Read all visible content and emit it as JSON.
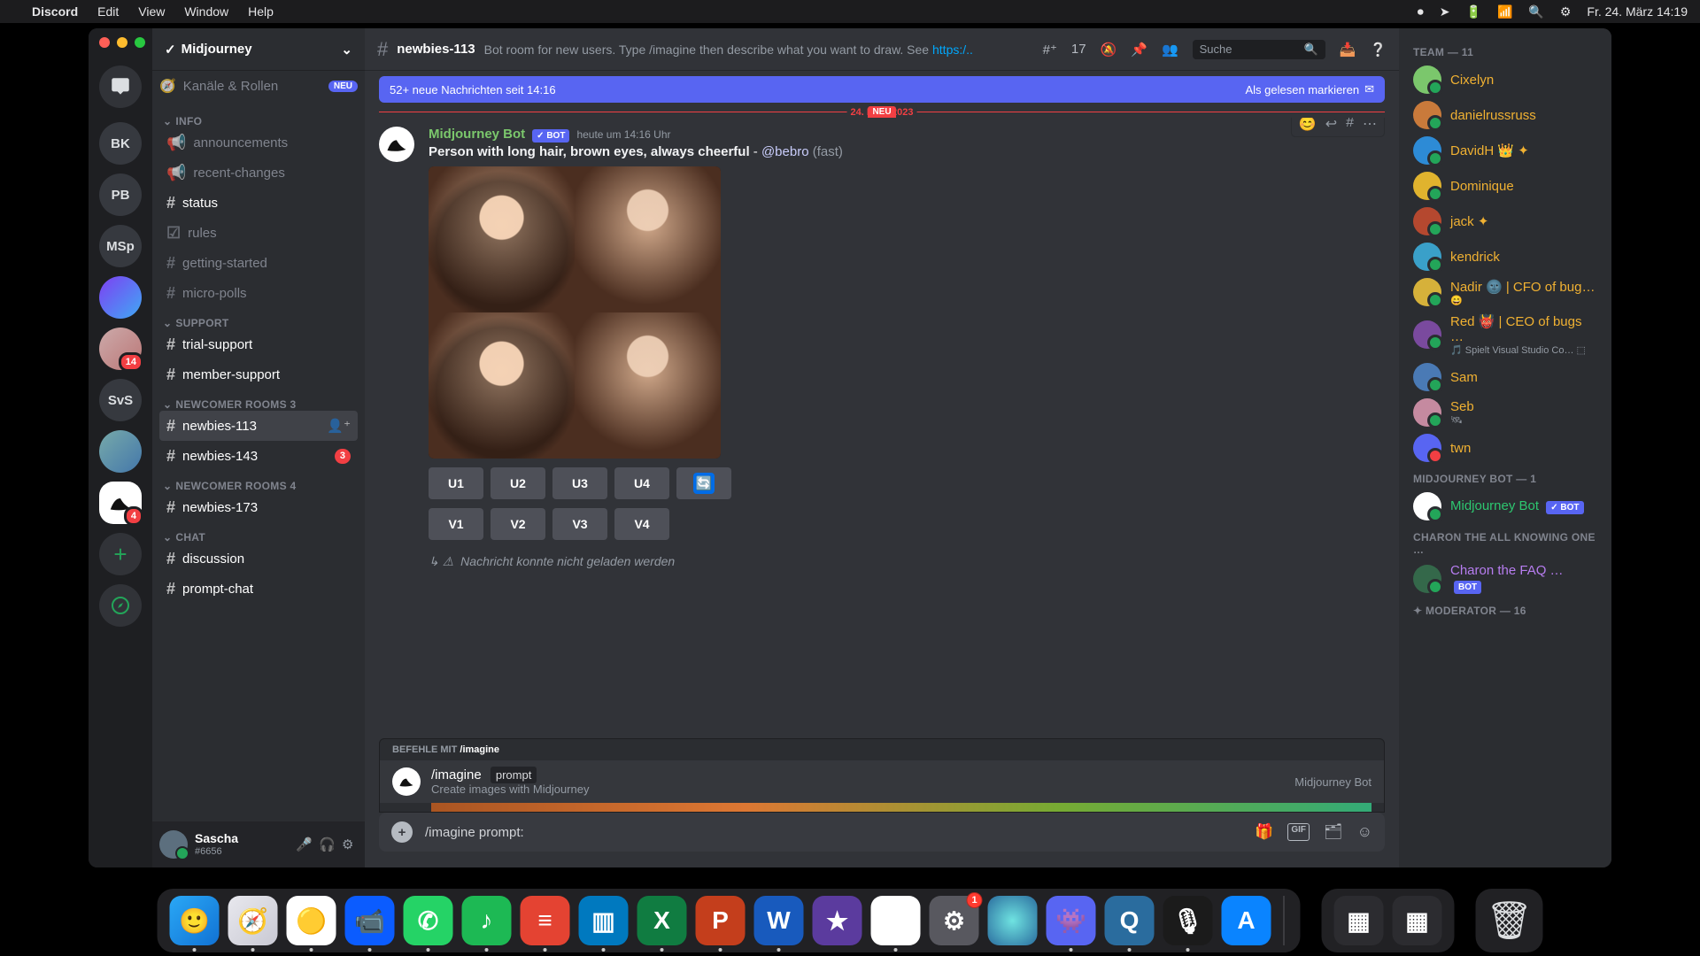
{
  "menubar": {
    "app": "Discord",
    "items": [
      "Edit",
      "View",
      "Window",
      "Help"
    ],
    "clock": "Fr. 24. März  14:19"
  },
  "guild": {
    "name": "Midjourney",
    "roles_label": "Kanäle & Rollen",
    "roles_new": "NEU"
  },
  "server_icons": [
    {
      "type": "home",
      "glyph": "💬"
    },
    {
      "type": "text",
      "label": "BK"
    },
    {
      "type": "text",
      "label": "PB"
    },
    {
      "type": "text",
      "label": "MSp"
    },
    {
      "type": "img"
    },
    {
      "type": "avatar",
      "badge": "14"
    },
    {
      "type": "text",
      "label": "SvS"
    },
    {
      "type": "avatar2"
    },
    {
      "type": "sel",
      "badge": "4"
    },
    {
      "type": "green",
      "glyph": "+"
    },
    {
      "type": "compass",
      "glyph": "🧭"
    }
  ],
  "categories": [
    {
      "name": "INFO",
      "channels": [
        {
          "icon": "📢",
          "name": "announcements"
        },
        {
          "icon": "📢",
          "name": "recent-changes"
        },
        {
          "icon": "#",
          "name": "status",
          "bright": true
        },
        {
          "icon": "☑",
          "name": "rules"
        },
        {
          "icon": "#",
          "name": "getting-started"
        },
        {
          "icon": "#",
          "name": "micro-polls"
        }
      ]
    },
    {
      "name": "SUPPORT",
      "channels": [
        {
          "icon": "#",
          "name": "trial-support",
          "bright": true
        },
        {
          "icon": "#",
          "name": "member-support",
          "bright": true
        }
      ]
    },
    {
      "name": "NEWCOMER ROOMS 3",
      "channels": [
        {
          "icon": "#",
          "name": "newbies-113",
          "selected": true,
          "add_icon": true
        },
        {
          "icon": "#",
          "name": "newbies-143",
          "bright": true,
          "badge": "3"
        }
      ]
    },
    {
      "name": "NEWCOMER ROOMS 4",
      "channels": [
        {
          "icon": "#",
          "name": "newbies-173",
          "bright": true
        }
      ]
    },
    {
      "name": "CHAT",
      "channels": [
        {
          "icon": "#",
          "name": "discussion",
          "bright": true
        },
        {
          "icon": "#",
          "name": "prompt-chat",
          "bright": true
        }
      ]
    }
  ],
  "user_panel": {
    "name": "Sascha",
    "tag": "#6656"
  },
  "topbar": {
    "channel": "newbies-113",
    "desc_prefix": "Bot room for new users. Type /imagine then describe what you want to draw. See ",
    "desc_link": "https:/..",
    "threads": "17",
    "search_placeholder": "Suche"
  },
  "banner": {
    "left": "52+ neue Nachrichten seit 14:16",
    "right": "Als gelesen markieren"
  },
  "divider": {
    "date": "24. März 2023",
    "neu": "NEU"
  },
  "message": {
    "author": "Midjourney Bot",
    "bot": "✓ BOT",
    "time": "heute um 14:16 Uhr",
    "prompt": "Person with long hair, brown eyes, always cheerful",
    "mention": "@bebro",
    "suffix": "(fast)",
    "buttons_u": [
      "U1",
      "U2",
      "U3",
      "U4"
    ],
    "buttons_v": [
      "V1",
      "V2",
      "V3",
      "V4"
    ],
    "error": "Nachricht konnte nicht geladen werden"
  },
  "command_popup": {
    "header_pre": "BEFEHLE MIT ",
    "header_cmd": "/imagine",
    "command": "/imagine",
    "param": "prompt",
    "desc": "Create images with Midjourney",
    "source": "Midjourney Bot"
  },
  "composer": {
    "text": "/imagine prompt:"
  },
  "members": {
    "team_header": "TEAM — 11",
    "team": [
      {
        "name": "Cixelyn",
        "color": "#f0b132",
        "av": "#7bc76c"
      },
      {
        "name": "danielrussruss",
        "color": "#f0b132",
        "av": "#c97a3b"
      },
      {
        "name": "DavidH 👑 ✦",
        "color": "#f0b132",
        "av": "#2d8bd6"
      },
      {
        "name": "Dominique",
        "color": "#f0b132",
        "av": "#e0b32e"
      },
      {
        "name": "jack ✦",
        "color": "#f0b132",
        "av": "#b5482f"
      },
      {
        "name": "kendrick",
        "color": "#f0b132",
        "av": "#3aa0c9"
      },
      {
        "name": "Nadir 🌚  | CFO of bug…",
        "color": "#f0b132",
        "av": "#d6b13a",
        "sub": "😄"
      },
      {
        "name": "Red 👹  | CEO of bugs …",
        "color": "#f0b132",
        "av": "#7a4a9e",
        "sub": "🎵 Spielt Visual Studio Co…  ⬚"
      },
      {
        "name": "Sam",
        "color": "#f0b132",
        "av": "#4a7ab5"
      },
      {
        "name": "Seb",
        "color": "#f0b132",
        "av": "#c58aa0",
        "sub": "🛰"
      },
      {
        "name": "twn",
        "color": "#f0b132",
        "av": "#5865f2",
        "dnd": true
      }
    ],
    "bot_header": "MIDJOURNEY BOT — 1",
    "bot": {
      "name": "Midjourney Bot",
      "tag": "✓ BOT"
    },
    "charon_header": "CHARON THE ALL KNOWING ONE …",
    "charon": {
      "name": "Charon the FAQ …",
      "tag": "BOT"
    },
    "mod_header": "✦ MODERATOR — 16"
  },
  "dock": [
    {
      "name": "finder",
      "bg": "linear-gradient(135deg,#2aa8f6,#1172d4)",
      "glyph": "🙂",
      "dot": true
    },
    {
      "name": "safari",
      "bg": "linear-gradient(135deg,#e8e8ee,#c9c9d3)",
      "glyph": "🧭",
      "dot": true
    },
    {
      "name": "chrome",
      "bg": "#fff",
      "glyph": "🟡",
      "dot": true
    },
    {
      "name": "zoom",
      "bg": "#0b5cff",
      "glyph": "📹",
      "dot": true
    },
    {
      "name": "whatsapp",
      "bg": "#25d366",
      "glyph": "✆",
      "dot": true
    },
    {
      "name": "spotify",
      "bg": "#1db954",
      "glyph": "♪",
      "dot": true
    },
    {
      "name": "todoist",
      "bg": "#e44332",
      "glyph": "≡",
      "dot": true
    },
    {
      "name": "trello",
      "bg": "#0079bf",
      "glyph": "▥",
      "dot": true
    },
    {
      "name": "excel",
      "bg": "#107c41",
      "glyph": "X",
      "dot": true
    },
    {
      "name": "powerpoint",
      "bg": "#c43e1c",
      "glyph": "P",
      "dot": true
    },
    {
      "name": "word",
      "bg": "#185abd",
      "glyph": "W",
      "dot": true
    },
    {
      "name": "imovie",
      "bg": "#5b3b9e",
      "glyph": "★"
    },
    {
      "name": "drive",
      "bg": "#fff",
      "glyph": "▲",
      "dot": true
    },
    {
      "name": "settings",
      "bg": "#58585f",
      "glyph": "⚙",
      "badge": "1"
    },
    {
      "name": "siri",
      "bg": "radial-gradient(circle,#6fe3e1,#2a6c9e)",
      "glyph": ""
    },
    {
      "name": "discord",
      "bg": "#5865f2",
      "glyph": "👾",
      "dot": true
    },
    {
      "name": "quicktime",
      "bg": "#2a6c9e",
      "glyph": "Q",
      "dot": true
    },
    {
      "name": "voice",
      "bg": "#1b1b1b",
      "glyph": "🎙",
      "dot": true
    },
    {
      "name": "appstore",
      "bg": "#0a84ff",
      "glyph": "A"
    }
  ],
  "dock2": [
    {
      "name": "mission1",
      "bg": "#2c2c30",
      "glyph": "▦"
    },
    {
      "name": "mission2",
      "bg": "#2c2c30",
      "glyph": "▦"
    }
  ]
}
